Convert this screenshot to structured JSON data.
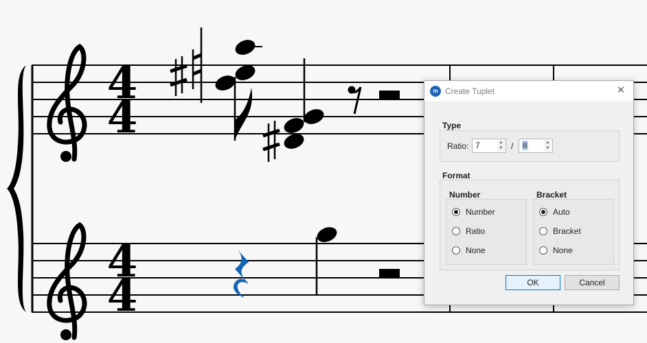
{
  "dialog": {
    "title": "Create Tuplet",
    "app_icon": "musescore-logo-icon",
    "type_section": {
      "heading": "Type",
      "ratio_label": "Ratio:",
      "numerator": "7",
      "separator": "/",
      "denominator": "8"
    },
    "format_section": {
      "heading": "Format",
      "number_group": {
        "heading": "Number",
        "options": [
          {
            "label": "Number",
            "selected": true
          },
          {
            "label": "Ratio",
            "selected": false
          },
          {
            "label": "None",
            "selected": false
          }
        ]
      },
      "bracket_group": {
        "heading": "Bracket",
        "options": [
          {
            "label": "Auto",
            "selected": true
          },
          {
            "label": "Bracket",
            "selected": false
          },
          {
            "label": "None",
            "selected": false
          }
        ]
      }
    },
    "ok_label": "OK",
    "cancel_label": "Cancel"
  },
  "score": {
    "time_signature": {
      "numerator": "4",
      "denominator": "4"
    },
    "selection_color": "#1464b4",
    "ink_color": "#000000"
  }
}
